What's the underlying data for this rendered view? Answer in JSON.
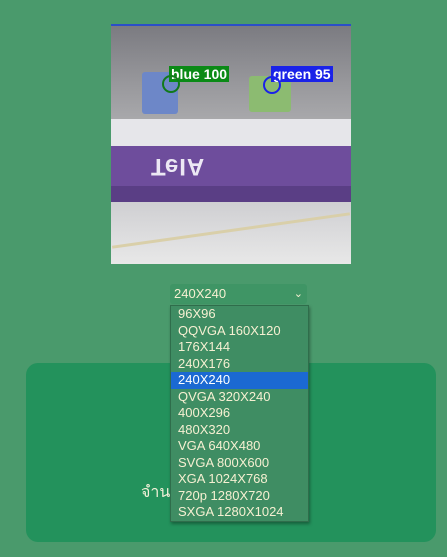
{
  "camera": {
    "detections": [
      {
        "label": "blue 100",
        "color": "#0b8a16"
      },
      {
        "label": "green 95",
        "color": "#1a22e8"
      }
    ],
    "board_text": "TeIA"
  },
  "resolution_select": {
    "selected": "240X240",
    "options": [
      "96X96",
      "QQVGA 160X120",
      "176X144",
      "240X176",
      "240X240",
      "QVGA 320X240",
      "400X296",
      "480X320",
      "VGA 640X480",
      "SVGA 800X600",
      "XGA 1024X768",
      "720p 1280X720",
      "SXGA 1280X1024"
    ],
    "selected_index": 4
  },
  "card": {
    "count_text": "จำนวน                              ที"
  },
  "colors": {
    "background": "#4a9a6c",
    "card": "#23925c",
    "highlight": "#1b69d2"
  }
}
